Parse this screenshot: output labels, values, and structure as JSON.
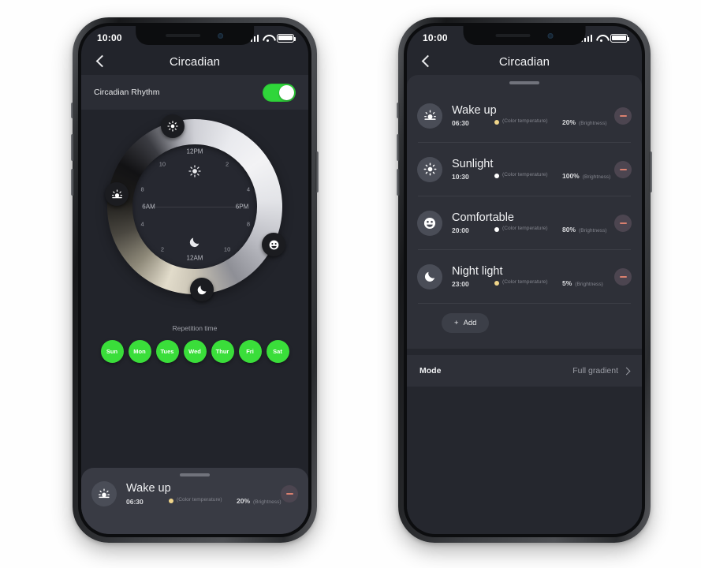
{
  "statusbar": {
    "time": "10:00",
    "signal_icon": "cellular-bars-icon",
    "wifi_icon": "wifi-icon",
    "battery_icon": "battery-full-icon"
  },
  "nav": {
    "back_icon": "chevron-left-icon",
    "title": "Circadian"
  },
  "left_screen": {
    "toggle_row": {
      "label": "Circadian Rhythm",
      "state": "on",
      "on_color": "#2fd63a"
    },
    "dial": {
      "inner_ticks": [
        "12PM",
        "2",
        "4",
        "6PM",
        "8",
        "10",
        "12AM",
        "2",
        "4",
        "6AM",
        "8",
        "10"
      ],
      "center_top_icon": "sun-icon",
      "center_bottom_icon": "moon-icon",
      "handles": [
        {
          "icon": "sun-icon",
          "name": "sunlight-handle",
          "angle_deg": 315
        },
        {
          "icon": "sunrise-icon",
          "name": "wake-up-handle",
          "angle_deg": 258
        },
        {
          "icon": "smiley-icon",
          "name": "comfortable-handle",
          "angle_deg": 120
        },
        {
          "icon": "moon-icon",
          "name": "night-light-handle",
          "angle_deg": 80
        }
      ]
    },
    "repetition": {
      "label": "Repetition time",
      "days": [
        "Sun",
        "Mon",
        "Tues",
        "Wed",
        "Thur",
        "Fri",
        "Sat"
      ],
      "active_color": "#3ade3a"
    },
    "sheet_item": {
      "icon": "sunrise-icon",
      "name": "Wake up",
      "time": "06:30",
      "color_temperature_label": "(Color temperature)",
      "color_temperature_swatch": "#f0d58a",
      "brightness_value": "20%",
      "brightness_label": "(Brightness)",
      "delete_icon": "minus-icon"
    }
  },
  "right_screen": {
    "schedules": [
      {
        "icon": "sunrise-icon",
        "name": "Wake up",
        "time": "06:30",
        "color_temperature_label": "(Color temperature)",
        "color_temperature_swatch": "#f0d58a",
        "brightness_value": "20%",
        "brightness_label": "(Brightness)",
        "delete_icon": "minus-icon"
      },
      {
        "icon": "sun-icon",
        "name": "Sunlight",
        "time": "10:30",
        "color_temperature_label": "(Color temperature)",
        "color_temperature_swatch": "#ffffff",
        "brightness_value": "100%",
        "brightness_label": "(Brightness)",
        "delete_icon": "minus-icon"
      },
      {
        "icon": "smiley-icon",
        "name": "Comfortable",
        "time": "20:00",
        "color_temperature_label": "(Color temperature)",
        "color_temperature_swatch": "#ffffff",
        "brightness_value": "80%",
        "brightness_label": "(Brightness)",
        "delete_icon": "minus-icon"
      },
      {
        "icon": "moon-icon",
        "name": "Night light",
        "time": "23:00",
        "color_temperature_label": "(Color temperature)",
        "color_temperature_swatch": "#f0d58a",
        "brightness_value": "5%",
        "brightness_label": "(Brightness)",
        "delete_icon": "minus-icon"
      }
    ],
    "add_button": {
      "label": "Add",
      "plus_icon": "plus-icon"
    },
    "mode_row": {
      "label": "Mode",
      "value": "Full gradient",
      "chevron_icon": "chevron-right-icon"
    }
  }
}
